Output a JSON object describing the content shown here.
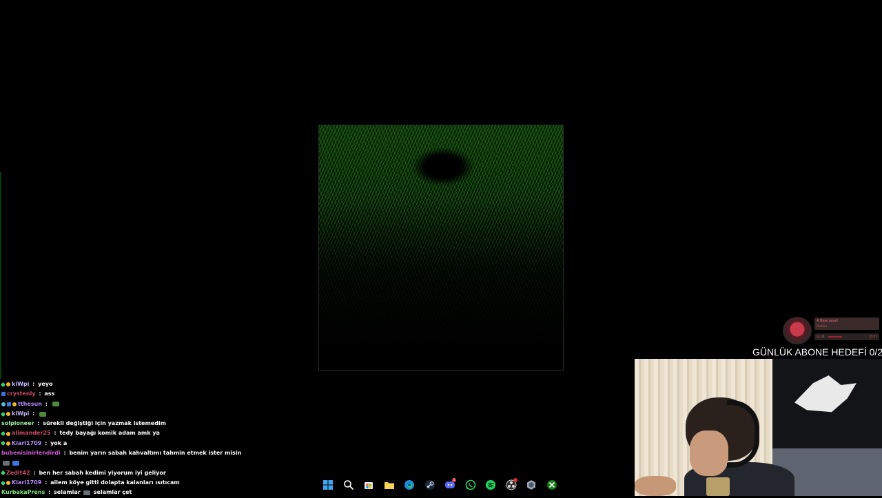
{
  "chat": {
    "messages": [
      {
        "badges": [
          "green",
          "gold"
        ],
        "user": "kiWpi",
        "color": "#c8b4ff",
        "text": "yeyo",
        "emotes": []
      },
      {
        "badges": [
          "blue"
        ],
        "user": "crystenly",
        "color": "#d04a6a",
        "text": "ass",
        "emotes": []
      },
      {
        "badges": [
          "cyan",
          "blue",
          "gold"
        ],
        "user": "tthesun",
        "color": "#b98cff",
        "text": "",
        "emotes": [
          "green"
        ]
      },
      {
        "badges": [
          "green",
          "gold"
        ],
        "user": "kiWpi",
        "color": "#c8b4ff",
        "text": "",
        "emotes": [
          "green"
        ]
      },
      {
        "badges": [],
        "user": "solpioneer",
        "color": "#9ef0a0",
        "text": "sürekli değiştiği için yazmak istemedim",
        "emotes": []
      },
      {
        "badges": [
          "green",
          "gold"
        ],
        "user": "alimander25",
        "color": "#d04a6a",
        "text": "tedy bayağı komik adam amk ya",
        "emotes": []
      },
      {
        "badges": [
          "green",
          "gold"
        ],
        "user": "Kiari1709",
        "color": "#b98cff",
        "text": "yok a",
        "emotes": []
      },
      {
        "badges": [],
        "user": "bubenisinirlendirdi",
        "color": "#d05ad0",
        "text": "benim yarın sabah kahvaltımı tahmin etmek ister misin",
        "emotes": []
      },
      {
        "badges": [],
        "user": "",
        "color": "#ffffff",
        "text": "",
        "emotes": [
          "gray",
          "blue"
        ]
      },
      {
        "badges": [
          "green"
        ],
        "user": "Zedit42",
        "color": "#d04a6a",
        "text": "ben her sabah kedimi yiyorum iyi geliyor",
        "emotes": []
      },
      {
        "badges": [
          "green",
          "gold"
        ],
        "user": "Kiari1709",
        "color": "#b98cff",
        "text": "ailem köye gitti dolapta kalanları ısıtıcam",
        "emotes": []
      },
      {
        "badges": [],
        "user": "KurbakaPrens",
        "color": "#7ee07e",
        "text": "selamlar",
        "emotes": [
          "gray"
        ],
        "text2": "selamlar çet"
      }
    ]
  },
  "overlay": {
    "music_title": "A New Level",
    "music_artist": "Pantera",
    "music_elapsed": "01:44",
    "music_total": "05:57",
    "music_progress": 0.29,
    "goal_text": "GÜNLÜK ABONE HEDEFİ 0/2"
  },
  "taskbar": {
    "icons": [
      "windows-start-icon",
      "search-icon",
      "microsoft-store-icon",
      "file-explorer-icon",
      "edge-browser-icon",
      "steam-icon",
      "discord-icon",
      "whatsapp-icon",
      "spotify-icon",
      "obs-icon",
      "app-icon",
      "xbox-icon"
    ],
    "discord_badge": "1"
  },
  "colors": {
    "game_green": "#2f8a24",
    "background": "#000000"
  }
}
